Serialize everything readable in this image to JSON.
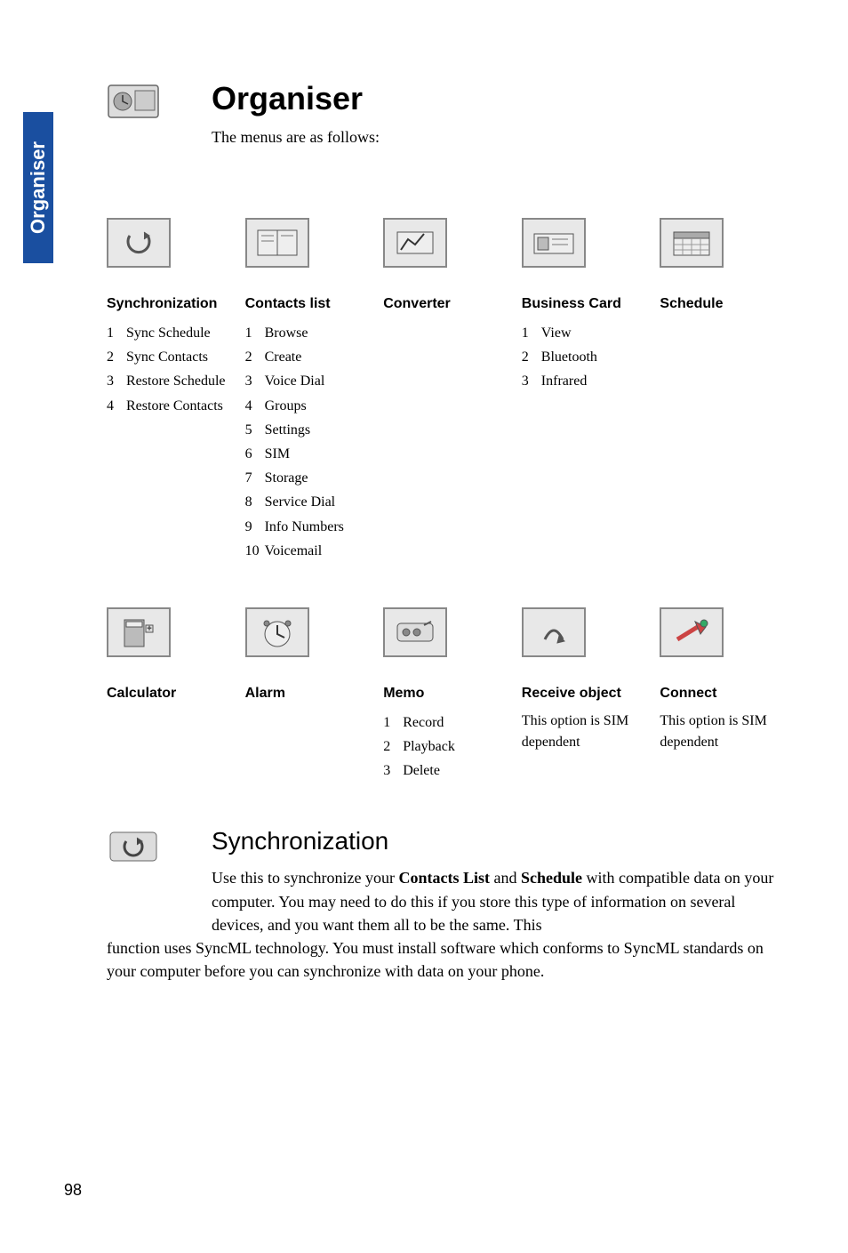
{
  "side_tab": "Organiser",
  "page_title": "Organiser",
  "intro_text": "The menus are as follows:",
  "row1": {
    "synchronization": {
      "heading": "Synchronization",
      "items": [
        "Sync Schedule",
        "Sync Contacts",
        "Restore Schedule",
        "Restore Contacts"
      ]
    },
    "contacts_list": {
      "heading": "Contacts list",
      "items": [
        "Browse",
        "Create",
        "Voice Dial",
        "Groups",
        "Settings",
        "SIM",
        "Storage",
        "Service Dial",
        "Info Numbers",
        "Voicemail"
      ]
    },
    "converter": {
      "heading": "Converter"
    },
    "business_card": {
      "heading": "Business Card",
      "items": [
        "View",
        "Bluetooth",
        "Infrared"
      ]
    },
    "schedule": {
      "heading": "Schedule"
    }
  },
  "row2": {
    "calculator": {
      "heading": "Calculator"
    },
    "alarm": {
      "heading": "Alarm"
    },
    "memo": {
      "heading": "Memo",
      "items": [
        "Record",
        "Playback",
        "Delete"
      ]
    },
    "receive_object": {
      "heading": "Receive object",
      "note": "This option is SIM dependent"
    },
    "connect": {
      "heading": "Connect",
      "note": "This option is SIM dependent"
    }
  },
  "section": {
    "heading": "Synchronization",
    "body_prefix": "Use this to synchronize your ",
    "bold1": "Contacts List",
    "mid": " and ",
    "bold2": "Schedule",
    "body_after": " with compatible data on your computer. You may need to do this if you store this type of information on several devices, and you want them all to be the same. This",
    "body_continued": "function uses SyncML technology. You must install software which conforms to SyncML standards on your computer before you can synchronize with data on your phone."
  },
  "page_number": "98"
}
